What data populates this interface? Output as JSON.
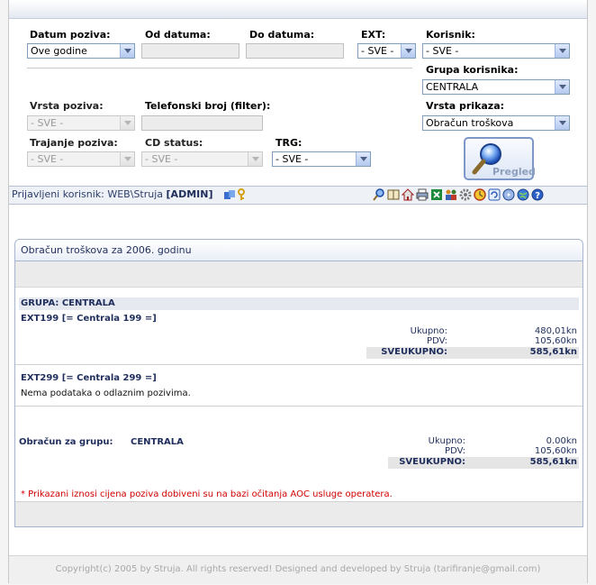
{
  "filters": {
    "datum_poziva": {
      "label": "Datum poziva:",
      "value": "Ove godine"
    },
    "od_datuma": {
      "label": "Od datuma:",
      "value": ""
    },
    "do_datuma": {
      "label": "Do datuma:",
      "value": ""
    },
    "ext": {
      "label": "EXT:",
      "value": "- SVE -"
    },
    "korisnik": {
      "label": "Korisnik:",
      "value": "- SVE -"
    },
    "grupa_korisnika": {
      "label": "Grupa korisnika:",
      "value": "CENTRALA"
    },
    "vrsta_poziva": {
      "label": "Vrsta poziva:",
      "value": "- SVE -"
    },
    "telefonski_broj": {
      "label": "Telefonski broj (filter):",
      "value": ""
    },
    "vrsta_prikaza": {
      "label": "Vrsta prikaza:",
      "value": "Obračun troškova"
    },
    "trajanje_poziva": {
      "label": "Trajanje poziva:",
      "value": "- SVE -"
    },
    "cd_status": {
      "label": "CD status:",
      "value": "- SVE -"
    },
    "trg": {
      "label": "TRG:",
      "value": "- SVE -"
    },
    "pregled_label": "Pregled"
  },
  "userbar": {
    "prefix": "Prijavljeni korisnik:",
    "user": "WEB\\Struja",
    "role": "[ADMIN]"
  },
  "toolbar_icons": [
    "search-icon",
    "book-icon",
    "home-icon",
    "print-icon",
    "excel-icon",
    "users-icon",
    "gear-icon",
    "clock-icon",
    "refresh-icon",
    "disk-icon",
    "globe-icon",
    "help-icon"
  ],
  "report": {
    "title": "Obračun troškova za 2006. godinu",
    "group_label": "GRUPA: CENTRALA",
    "ext1": {
      "name": "EXT199 [= Centrala 199 =]",
      "ukupno_label": "Ukupno:",
      "ukupno": "480,01kn",
      "pdv_label": "PDV:",
      "pdv": "105,60kn",
      "sveukupno_label": "SVEUKUPNO:",
      "sveukupno": "585,61kn"
    },
    "ext2": {
      "name": "EXT299 [= Centrala 299 =]",
      "message": "Nema podataka o odlaznim pozivima."
    },
    "summary": {
      "label": "Obračun za grupu:",
      "group": "CENTRALA",
      "ukupno_label": "Ukupno:",
      "ukupno": "0.00kn",
      "pdv_label": "PDV:",
      "pdv": "105,60kn",
      "sveukupno_label": "SVEUKUPNO:",
      "sveukupno": "585,61kn"
    },
    "note": "* Prikazani iznosi cijena poziva dobiveni su na bazi očitanja AOC usluge operatera."
  },
  "footer": "Copyright(c) 2005 by Struja. All rights reserved! Designed and developed by Struja (tarifiranje@gmail.com)"
}
